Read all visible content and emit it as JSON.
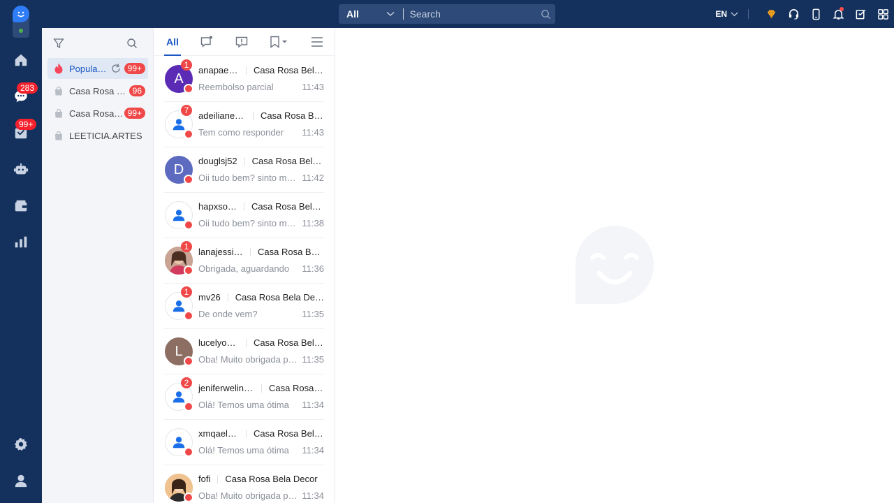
{
  "topbar": {
    "scope": "All",
    "search_placeholder": "Search",
    "lang": "EN"
  },
  "leftnav": {
    "chats_badge": "283",
    "orders_badge": "99+"
  },
  "folders": {
    "items": [
      {
        "label": "Popular Shop",
        "badge": "99+"
      },
      {
        "label": "Casa Rosa Bela",
        "badge": "96"
      },
      {
        "label": "Casa Rosa Bela",
        "badge": "99+"
      },
      {
        "label": "LEETICIA.ARTES",
        "badge": ""
      }
    ]
  },
  "conv_tabs": {
    "all": "All"
  },
  "conversations": [
    {
      "name": "anapaeolo",
      "shop": "Casa Rosa Bela Decor",
      "message": "Reembolso parcial",
      "time": "11:43",
      "unread": "1",
      "avatar_letter": "A",
      "avatar_color": "#5b2bb5"
    },
    {
      "name": "adeilianedias",
      "shop": "Casa Rosa Bela Decor",
      "message": "Tem como responder",
      "time": "11:43",
      "unread": "7",
      "avatar_letter": "",
      "avatar_color": ""
    },
    {
      "name": "douglsj52",
      "shop": "Casa Rosa Bela Decor",
      "message": "Oii tudo bem? sinto muito",
      "time": "11:42",
      "unread": "",
      "avatar_letter": "D",
      "avatar_color": "#5c6bc0"
    },
    {
      "name": "hapxsocial",
      "shop": "Casa Rosa Bela Decor",
      "message": "Oii tudo bem? sinto muito",
      "time": "11:38",
      "unread": "",
      "avatar_letter": "",
      "avatar_color": ""
    },
    {
      "name": "lanajessica",
      "shop": "Casa Rosa Bela Decor",
      "message": "Obrigada, aguardando",
      "time": "11:36",
      "unread": "1",
      "avatar_letter": "",
      "avatar_color": "#b98a7a"
    },
    {
      "name": "mv26",
      "shop": "Casa Rosa Bela Decor",
      "message": "De onde vem?",
      "time": "11:35",
      "unread": "1",
      "avatar_letter": "",
      "avatar_color": ""
    },
    {
      "name": "lucelyosantos",
      "shop": "Casa Rosa Bela Decor",
      "message": "Oba! Muito obrigada pela",
      "time": "11:35",
      "unread": "",
      "avatar_letter": "L",
      "avatar_color": "#8d6e63"
    },
    {
      "name": "jeniferwelington",
      "shop": "Casa Rosa Bela Decor",
      "message": "Olá! Temos uma ótima",
      "time": "11:34",
      "unread": "2",
      "avatar_letter": "",
      "avatar_color": ""
    },
    {
      "name": "xmqaelsilva",
      "shop": "Casa Rosa Bela Decor",
      "message": "Olá! Temos uma ótima",
      "time": "11:34",
      "unread": "",
      "avatar_letter": "",
      "avatar_color": ""
    },
    {
      "name": "fofi",
      "shop": "Casa Rosa Bela Decor",
      "message": "Oba! Muito obrigada pela",
      "time": "11:34",
      "unread": "",
      "avatar_letter": "",
      "avatar_color": "#e8b88a"
    }
  ]
}
